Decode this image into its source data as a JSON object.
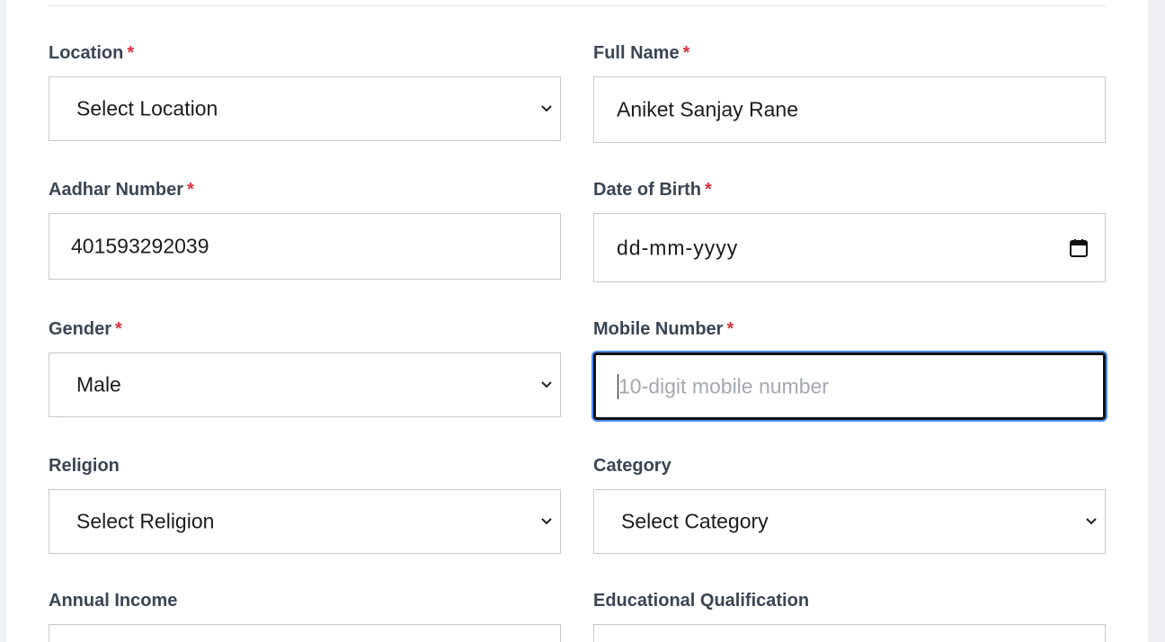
{
  "form": {
    "location": {
      "label": "Location",
      "required_mark": "*",
      "value": "Select Location"
    },
    "full_name": {
      "label": "Full Name",
      "required_mark": "*",
      "value": "Aniket Sanjay Rane"
    },
    "aadhar": {
      "label": "Aadhar Number",
      "required_mark": "*",
      "value": "401593292039"
    },
    "dob": {
      "label": "Date of Birth",
      "required_mark": "*",
      "value": "dd-mm-yyyy"
    },
    "gender": {
      "label": "Gender",
      "required_mark": "*",
      "value": "Male"
    },
    "mobile": {
      "label": "Mobile Number",
      "required_mark": "*",
      "placeholder": "10-digit mobile number",
      "value": ""
    },
    "religion": {
      "label": "Religion",
      "value": "Select Religion"
    },
    "category": {
      "label": "Category",
      "value": "Select Category"
    },
    "annual_income": {
      "label": "Annual Income"
    },
    "education": {
      "label": "Educational Qualification"
    }
  },
  "icons": {
    "select": "chevron-down-icon",
    "date": "calendar-icon"
  }
}
